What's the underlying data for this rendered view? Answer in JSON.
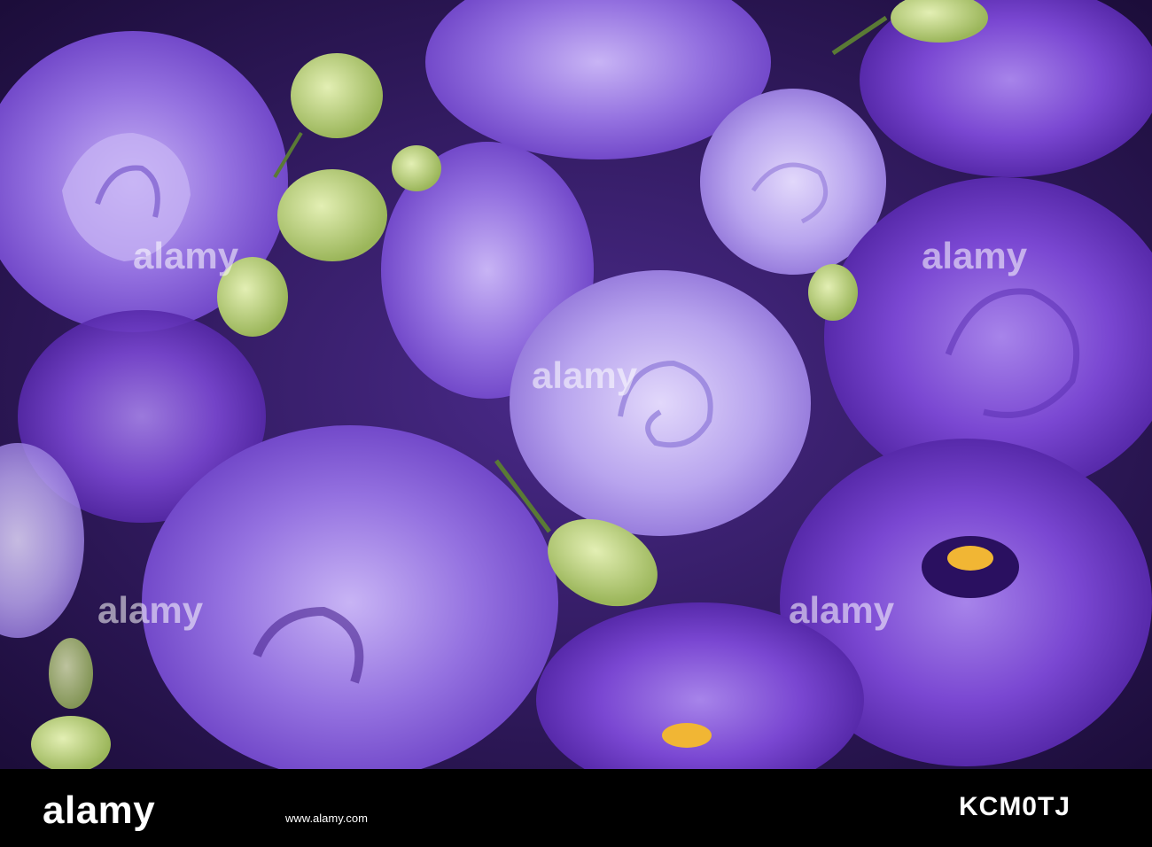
{
  "photo": {
    "subject": "purple lisianthus flowers with green buds",
    "colors": {
      "background": "#2a1650",
      "deep_purple": "#5a2aa8",
      "violet": "#7f57d6",
      "lavender": "#b7a3ec",
      "pale": "#d4c8f5",
      "bud_green": "#b8d07a",
      "stamen": "#f1b634"
    }
  },
  "watermark": {
    "brand": "alamy",
    "image_id": "KCM0TJ",
    "site": "www.alamy.com"
  }
}
